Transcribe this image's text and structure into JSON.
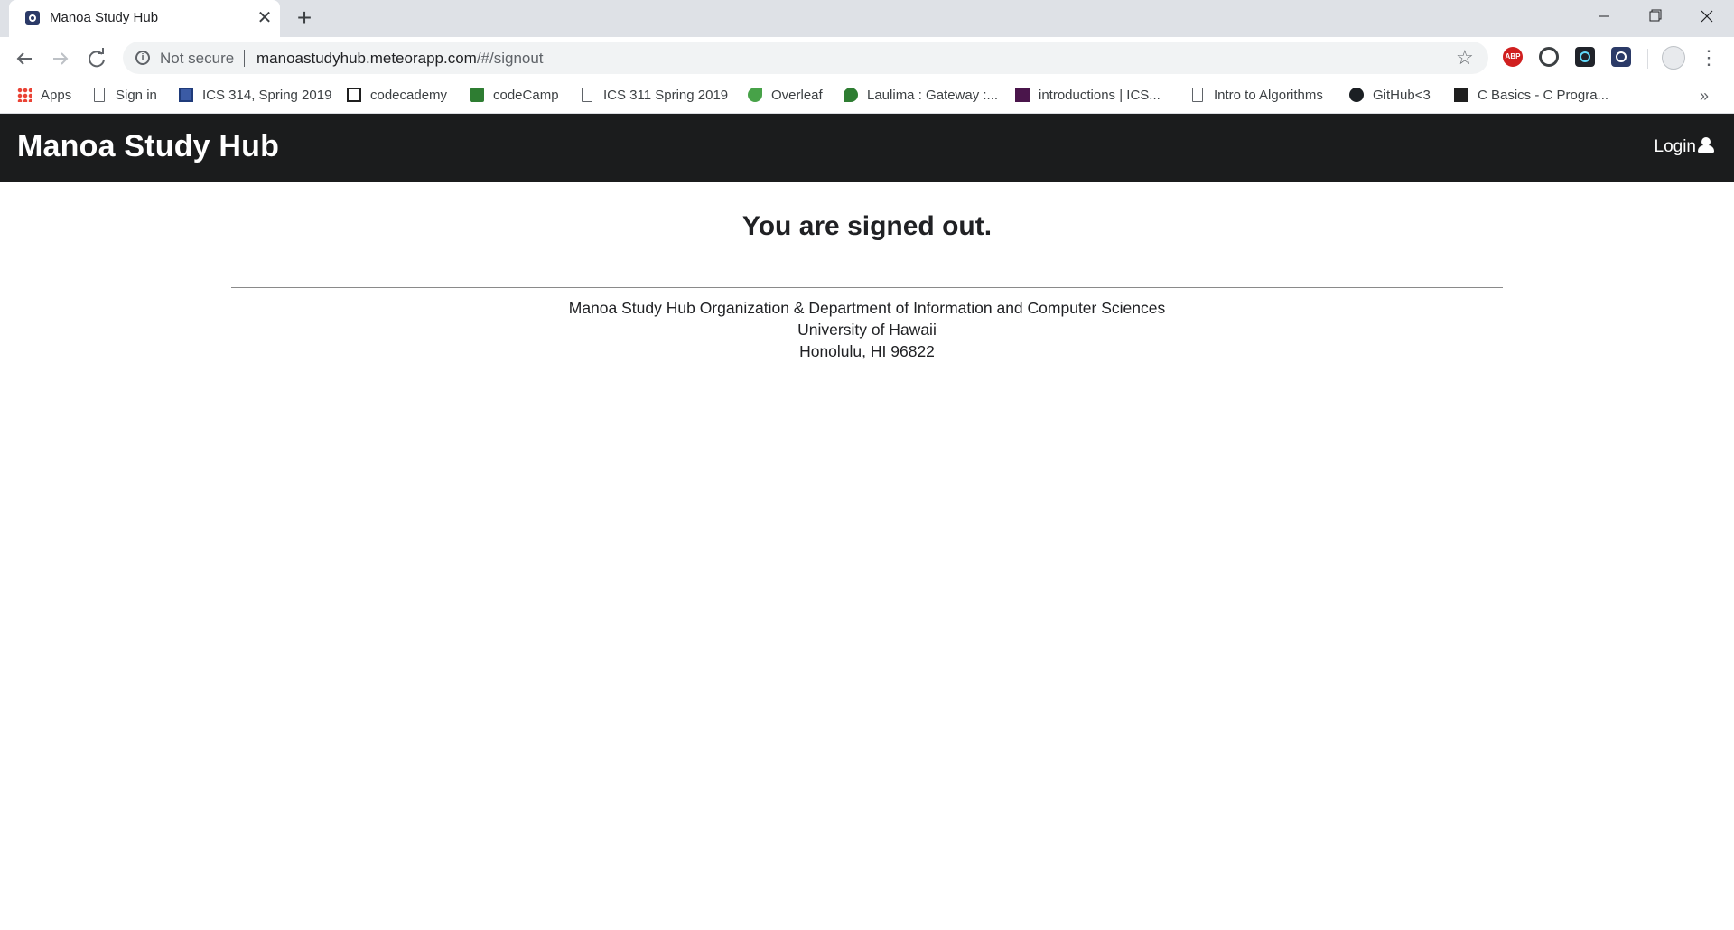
{
  "browser": {
    "tab": {
      "title": "Manoa Study Hub",
      "close": "✕",
      "new_tab": "+"
    },
    "window_controls": {
      "minimize": "—",
      "maximize": "❐",
      "close": "✕"
    },
    "omnibox": {
      "security_label": "Not secure",
      "url_host": "manoastudyhub.meteorapp.com",
      "url_path": "/#/signout"
    },
    "extensions": {
      "abp_label": "ABP"
    },
    "bookmarks": [
      {
        "label": "Apps",
        "icon": "apps-grid-icon"
      },
      {
        "label": "Sign in",
        "icon": "page-icon"
      },
      {
        "label": "ICS 314, Spring 2019",
        "icon": "course-icon"
      },
      {
        "label": "codecademy",
        "icon": "codecademy-icon"
      },
      {
        "label": "codeCamp",
        "icon": "freecodecamp-icon"
      },
      {
        "label": "ICS 311 Spring 2019",
        "icon": "page-icon"
      },
      {
        "label": "Overleaf",
        "icon": "overleaf-icon"
      },
      {
        "label": "Laulima : Gateway :...",
        "icon": "laulima-icon"
      },
      {
        "label": "introductions | ICS...",
        "icon": "slack-icon"
      },
      {
        "label": "Intro to Algorithms",
        "icon": "page-icon"
      },
      {
        "label": "GitHub<3",
        "icon": "github-icon"
      },
      {
        "label": "C Basics - C Progra...",
        "icon": "terminal-icon"
      }
    ],
    "bookmarks_overflow": "»"
  },
  "site": {
    "brand": "Manoa Study Hub",
    "login_label": "Login"
  },
  "main": {
    "headline": "You are signed out."
  },
  "footer": {
    "line1": "Manoa Study Hub Organization & Department of Information and Computer Sciences",
    "line2": "University of Hawaii",
    "line3": "Honolulu, HI 96822"
  },
  "colors": {
    "navbar_bg": "#1b1c1d",
    "tabstrip_bg": "#dee1e6",
    "omnibox_bg": "#f1f3f4"
  }
}
